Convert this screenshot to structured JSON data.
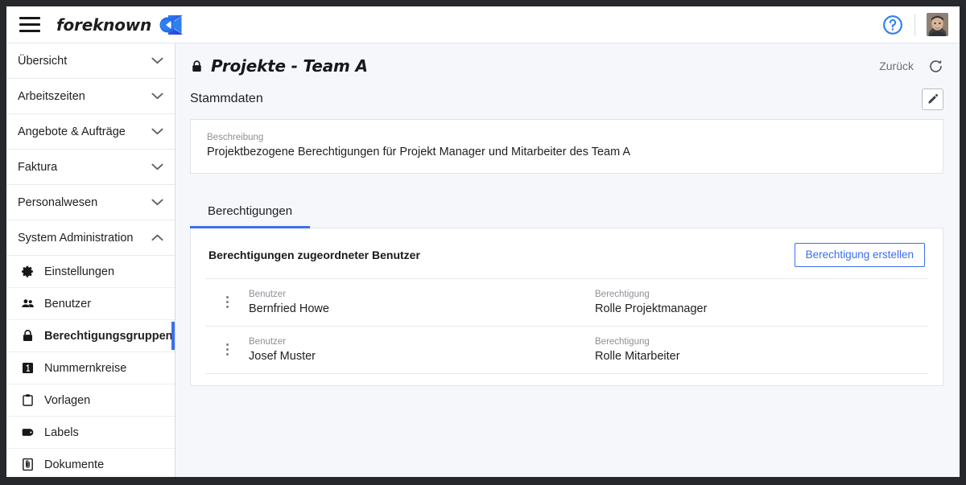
{
  "topbar": {
    "menu_icon": "hamburger-icon",
    "brand_name": "foreknown",
    "brand_logo_icon": "foreknown-logo-icon",
    "help_icon": "help-circle-icon",
    "avatar_icon": "user-avatar"
  },
  "sidebar": {
    "groups": [
      {
        "label": "Übersicht",
        "icon": "chevron-down-icon",
        "expanded": false
      },
      {
        "label": "Arbeitszeiten",
        "icon": "chevron-down-icon",
        "expanded": false
      },
      {
        "label": "Angebote & Aufträge",
        "icon": "chevron-down-icon",
        "expanded": false
      },
      {
        "label": "Faktura",
        "icon": "chevron-down-icon",
        "expanded": false
      },
      {
        "label": "Personalwesen",
        "icon": "chevron-down-icon",
        "expanded": false
      },
      {
        "label": "System Administration",
        "icon": "chevron-up-icon",
        "expanded": true
      }
    ],
    "items": [
      {
        "label": "Einstellungen",
        "icon": "gear-icon",
        "active": false
      },
      {
        "label": "Benutzer",
        "icon": "users-icon",
        "active": false
      },
      {
        "label": "Berechtigungsgruppen",
        "icon": "lock-icon",
        "active": true
      },
      {
        "label": "Nummernkreise",
        "icon": "number-box-icon",
        "active": false
      },
      {
        "label": "Vorlagen",
        "icon": "clipboard-icon",
        "active": false
      },
      {
        "label": "Labels",
        "icon": "tag-icon",
        "active": false
      },
      {
        "label": "Dokumente",
        "icon": "document-icon",
        "active": false
      }
    ]
  },
  "page": {
    "lock_icon": "lock-icon",
    "title": "Projekte - Team A",
    "back_label": "Zurück",
    "refresh_icon": "refresh-icon"
  },
  "stammdaten": {
    "section_title": "Stammdaten",
    "edit_icon": "pencil-icon",
    "description_label": "Beschreibung",
    "description_value": "Projektbezogene Berechtigungen für Projekt Manager und Mitarbeiter des Team A"
  },
  "tabs": [
    {
      "label": "Berechtigungen",
      "active": true
    }
  ],
  "permissions": {
    "title": "Berechtigungen zugeordneter Benutzer",
    "create_button": "Berechtigung erstellen",
    "columns": {
      "user": "Benutzer",
      "permission": "Berechtigung"
    },
    "rows": [
      {
        "menu_icon": "kebab-menu-icon",
        "user_label": "Benutzer",
        "user": "Bernfried Howe",
        "permission_label": "Berechtigung",
        "permission": "Rolle Projektmanager"
      },
      {
        "menu_icon": "kebab-menu-icon",
        "user_label": "Benutzer",
        "user": "Josef Muster",
        "permission_label": "Berechtigung",
        "permission": "Rolle Mitarbeiter"
      }
    ]
  },
  "colors": {
    "accent": "#3b6ef0",
    "frame": "#26282c",
    "page_bg": "#f5f7fa",
    "card_bg": "#ffffff",
    "muted_text": "#8b9096"
  }
}
